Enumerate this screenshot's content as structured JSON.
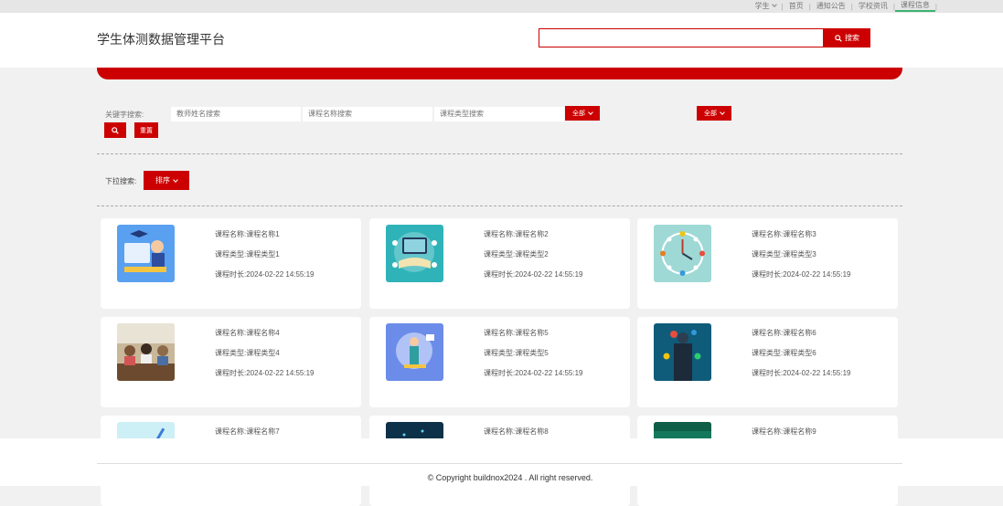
{
  "topnav": {
    "user": "学生",
    "home": "首页",
    "notice": "通知公告",
    "news": "学校资讯",
    "course": "课程信息"
  },
  "header": {
    "brand": "学生体测数据管理平台",
    "search_value": "",
    "search_label": "搜索"
  },
  "filters": {
    "keyword_label": "关键字搜索:",
    "teacher_placeholder": "教师姓名搜索",
    "course_name_placeholder": "课程名称搜索",
    "course_type_placeholder": "课程类型搜索",
    "all_label_1": "全部",
    "all_label_2": "全部",
    "reset_label": "重置",
    "dropdown_label": "下拉搜索:",
    "sort_label": "排序"
  },
  "courses": [
    {
      "name": "课程名称:课程名称1",
      "type": "课程类型:课程类型1",
      "duration": "课程时长:2024-02-22 14:55:19",
      "image": "book-study-illustration"
    },
    {
      "name": "课程名称:课程名称2",
      "type": "课程类型:课程类型2",
      "duration": "课程时长:2024-02-22 14:55:19",
      "image": "laptop-book-illustration"
    },
    {
      "name": "课程名称:课程名称3",
      "type": "课程类型:课程类型3",
      "duration": "课程时长:2024-02-22 14:55:19",
      "image": "clock-illustration"
    },
    {
      "name": "课程名称:课程名称4",
      "type": "课程类型:课程类型4",
      "duration": "课程时长:2024-02-22 14:55:19",
      "image": "classroom-photo"
    },
    {
      "name": "课程名称:课程名称5",
      "type": "课程类型:课程类型5",
      "duration": "课程时长:2024-02-22 14:55:19",
      "image": "teacher-illustration"
    },
    {
      "name": "课程名称:课程名称6",
      "type": "课程类型:课程类型6",
      "duration": "课程时长:2024-02-22 14:55:19",
      "image": "business-tech-image"
    },
    {
      "name": "课程名称:课程名称7",
      "image": "light-illustration"
    },
    {
      "name": "课程名称:课程名称8",
      "image": "dark-tech-image"
    },
    {
      "name": "课程名称:课程名称9",
      "image": "green-card-image"
    }
  ],
  "footer": {
    "copyright": "© Copyright buildnox2024 . All right reserved."
  }
}
